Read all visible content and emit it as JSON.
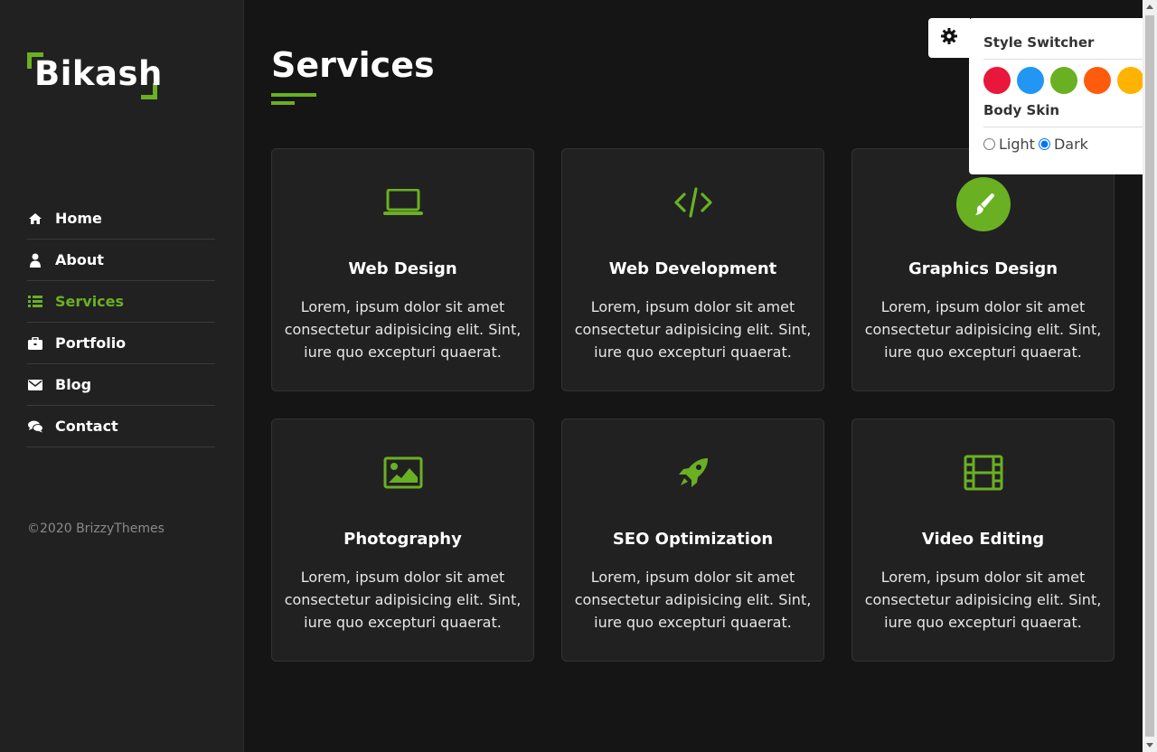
{
  "brand": {
    "logo_text": "Bikash",
    "accent_color": "#6ab023"
  },
  "nav": {
    "items": [
      {
        "label": "Home",
        "icon": "home-icon",
        "active": false
      },
      {
        "label": "About",
        "icon": "user-icon",
        "active": false
      },
      {
        "label": "Services",
        "icon": "list-icon",
        "active": true
      },
      {
        "label": "Portfolio",
        "icon": "briefcase-icon",
        "active": false
      },
      {
        "label": "Blog",
        "icon": "envelope-icon",
        "active": false
      },
      {
        "label": "Contact",
        "icon": "comments-icon",
        "active": false
      }
    ]
  },
  "footer": {
    "copyright": "©2020 BrizzyThemes"
  },
  "main": {
    "title": "Services",
    "cards": [
      {
        "title": "Web Design",
        "icon": "laptop-icon",
        "description": "Lorem, ipsum dolor sit amet consectetur adipisicing elit. Sint, iure quo excepturi quaerat."
      },
      {
        "title": "Web Development",
        "icon": "code-icon",
        "description": "Lorem, ipsum dolor sit amet consectetur adipisicing elit. Sint, iure quo excepturi quaerat."
      },
      {
        "title": "Graphics Design",
        "icon": "paintbrush-icon",
        "description": "Lorem, ipsum dolor sit amet consectetur adipisicing elit. Sint, iure quo excepturi quaerat."
      },
      {
        "title": "Photography",
        "icon": "image-icon",
        "description": "Lorem, ipsum dolor sit amet consectetur adipisicing elit. Sint, iure quo excepturi quaerat."
      },
      {
        "title": "SEO Optimization",
        "icon": "rocket-icon",
        "description": "Lorem, ipsum dolor sit amet consectetur adipisicing elit. Sint, iure quo excepturi quaerat."
      },
      {
        "title": "Video Editing",
        "icon": "film-icon",
        "description": "Lorem, ipsum dolor sit amet consectetur adipisicing elit. Sint, iure quo excepturi quaerat."
      }
    ]
  },
  "style_switcher": {
    "title": "Style Switcher",
    "colors": [
      "#e8173b",
      "#2196f3",
      "#6ab023",
      "#fe5c0c",
      "#ffb300"
    ],
    "body_skin_label": "Body Skin",
    "skin_options": [
      "Light",
      "Dark"
    ],
    "selected_skin": "Dark"
  }
}
